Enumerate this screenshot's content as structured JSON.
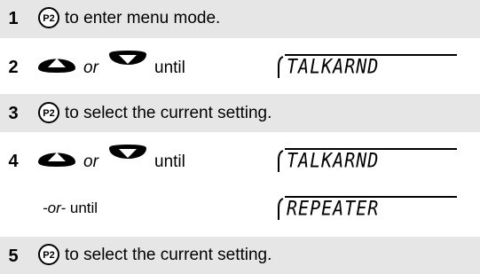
{
  "steps": [
    {
      "number": "1",
      "button_label": "P2",
      "text": "to enter menu mode."
    },
    {
      "number": "2",
      "or_text": "or",
      "until_text": "until",
      "display": "TALKARND"
    },
    {
      "number": "3",
      "button_label": "P2",
      "text": "to select the current setting."
    },
    {
      "number": "4",
      "or_text": "or",
      "until_text": "until",
      "display": "TALKARND"
    },
    {
      "alt_prefix": "-or-",
      "alt_text": " until",
      "display": "REPEATER"
    },
    {
      "number": "5",
      "button_label": "P2",
      "text": "to select the current setting."
    }
  ]
}
